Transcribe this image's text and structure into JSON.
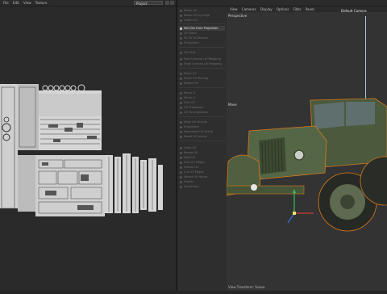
{
  "menubar": {
    "items": [
      "File",
      "Edit",
      "View",
      "Texture"
    ],
    "uv_set": "Project"
  },
  "tools": {
    "items": [
      {
        "label": "Relax UV",
        "active": false
      },
      {
        "label": "Relax UV By Edge",
        "active": false
      },
      {
        "label": "Unfold UV",
        "active": false
      },
      {
        "label": "Set UVs from Projection",
        "active": true
      },
      {
        "label": "UV Stack",
        "active": false
      },
      {
        "label": "Fit UV to Bounds",
        "active": false
      },
      {
        "label": "Straighten",
        "active": false
      },
      {
        "label": "UV Pack",
        "active": false
      },
      {
        "label": "Face Unwrap UV Mapping",
        "active": false
      },
      {
        "label": "Edge Unwrap UV Mapping",
        "active": false
      },
      {
        "label": "Move UV",
        "active": false
      },
      {
        "label": "Scale UV Pinning",
        "active": false
      },
      {
        "label": "Rotate UV",
        "active": false
      },
      {
        "label": "Mirror U",
        "active": false
      },
      {
        "label": "Mirror V",
        "active": false
      },
      {
        "label": "Grid UV",
        "active": false
      },
      {
        "label": "UV Projection",
        "active": false
      },
      {
        "label": "UV Re-projection",
        "active": false
      },
      {
        "label": "Align UV Islands",
        "active": false
      },
      {
        "label": "Straighten",
        "active": false
      },
      {
        "label": "Normalize UV Island",
        "active": false
      },
      {
        "label": "Reset UV Island",
        "active": false
      },
      {
        "label": "Clear UV",
        "active": false
      },
      {
        "label": "Merge UV",
        "active": false
      },
      {
        "label": "Split UV",
        "active": false
      },
      {
        "label": "Sew UV Edges",
        "active": false
      },
      {
        "label": "Unsew UV",
        "active": false
      },
      {
        "label": "Cut UV Edges",
        "active": false
      },
      {
        "label": "Select UV Island",
        "active": false
      },
      {
        "label": "Flatten",
        "active": false
      },
      {
        "label": "Symmetry",
        "active": false
      }
    ]
  },
  "viewport": {
    "menu": [
      "View",
      "Cameras",
      "Display",
      "Options",
      "Filter",
      "Panel"
    ],
    "perspective": "Perspective",
    "camera": "Default Camera",
    "tool_hint": "Move",
    "status": "View Transform: Scene"
  },
  "colors": {
    "truck_body": "#4b5a3c",
    "selection_outline": "#d7791c",
    "axis_x": "#d23b3b",
    "axis_y": "#37c25a",
    "axis_z": "#3b6fd2"
  }
}
